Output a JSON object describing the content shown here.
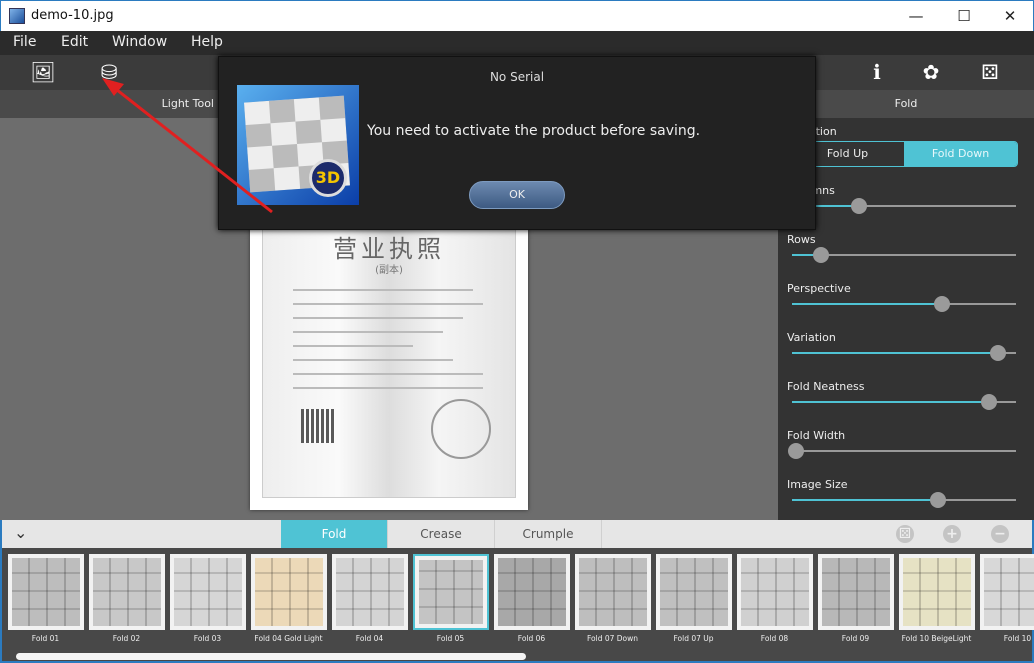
{
  "window": {
    "title": "demo-10.jpg",
    "min": "—",
    "max": "☐",
    "close": "✕"
  },
  "menu": [
    "File",
    "Edit",
    "Window",
    "Help"
  ],
  "toolbar": {
    "left": [
      {
        "icon": "image-icon",
        "glyph": "🖼"
      },
      {
        "icon": "save-icon",
        "glyph": "⛁"
      }
    ],
    "right": [
      {
        "icon": "info-icon",
        "glyph": "ℹ"
      },
      {
        "icon": "settings-icon",
        "glyph": "✿"
      },
      {
        "icon": "dice-icon",
        "glyph": "⚄"
      }
    ]
  },
  "left_panel": {
    "header": "Light Tool"
  },
  "document": {
    "heading": "营业执照",
    "sub": "(副本)"
  },
  "right_panel": {
    "header": "Fold",
    "direction_label": "Direction",
    "direction_options": [
      "Fold Up",
      "Fold Down"
    ],
    "direction_selected": "Fold Down",
    "sliders": [
      {
        "label": "Columns",
        "value": 30
      },
      {
        "label": "Rows",
        "value": 13
      },
      {
        "label": "Perspective",
        "value": 67
      },
      {
        "label": "Variation",
        "value": 92
      },
      {
        "label": "Fold Neatness",
        "value": 88
      },
      {
        "label": "Fold Width",
        "value": 2
      },
      {
        "label": "Image Size",
        "value": 65
      }
    ]
  },
  "dialog": {
    "title": "No Serial",
    "message": "You need to activate the product before saving.",
    "ok": "OK",
    "logo_text": "3D"
  },
  "bottom": {
    "collapse": "⌄",
    "tabs": [
      "Fold",
      "Crease",
      "Crumple"
    ],
    "active_tab": "Fold",
    "actions": [
      {
        "icon": "random-icon",
        "glyph": "⚄"
      },
      {
        "icon": "add-icon",
        "glyph": "+"
      },
      {
        "icon": "remove-icon",
        "glyph": "−"
      }
    ],
    "presets": [
      {
        "name": "Fold 01",
        "tint": "#bdbdbd"
      },
      {
        "name": "Fold 02",
        "tint": "#c8c8c8"
      },
      {
        "name": "Fold 03",
        "tint": "#d6d6d6"
      },
      {
        "name": "Fold 04 Gold Light",
        "tint": "#ecd9b8"
      },
      {
        "name": "Fold 04",
        "tint": "#d4d4d4"
      },
      {
        "name": "Fold 05",
        "tint": "#c4c4c4"
      },
      {
        "name": "Fold 06",
        "tint": "#a8a8a8"
      },
      {
        "name": "Fold 07 Down",
        "tint": "#bebebe"
      },
      {
        "name": "Fold 07 Up",
        "tint": "#c0c0c0"
      },
      {
        "name": "Fold 08",
        "tint": "#d0d0d0"
      },
      {
        "name": "Fold 09",
        "tint": "#b8b8b8"
      },
      {
        "name": "Fold 10 BeigeLight",
        "tint": "#e6e2c4"
      },
      {
        "name": "Fold 10",
        "tint": "#d8d8d8"
      }
    ],
    "selected": "Fold 05",
    "scroll_fraction": 0.5
  },
  "colors": {
    "accent": "#4fc3d4",
    "arrow": "#e02020"
  }
}
